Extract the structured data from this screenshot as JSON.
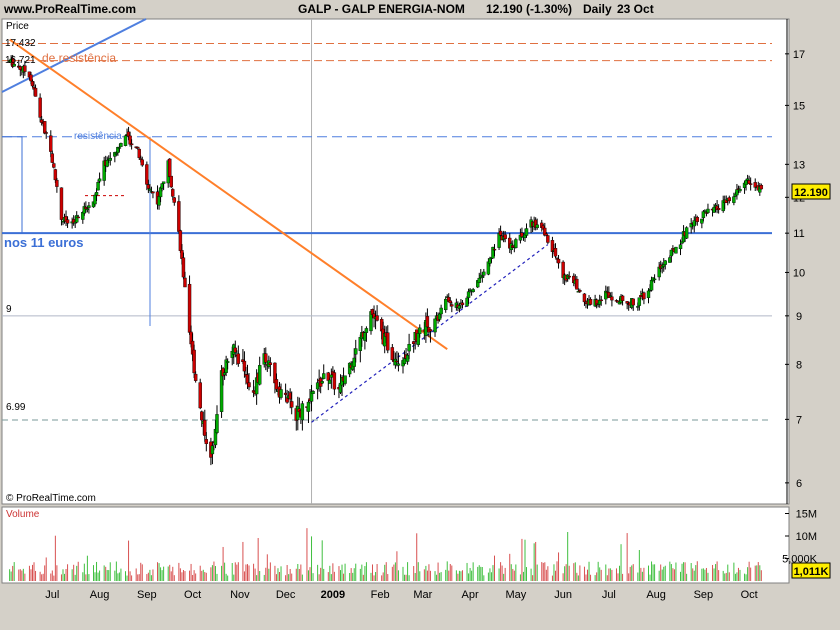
{
  "header": {
    "site": "www.ProRealTime.com",
    "title": "GALP - GALP ENERGIA-NOM",
    "last": "12.190 (-1.30%)",
    "period": "Daily",
    "date": "23 Oct"
  },
  "panel_labels": {
    "price": "Price",
    "volume": "Volume",
    "copyright": "© ProRealTime.com"
  },
  "price_axis": {
    "ticks": [
      "17",
      "15",
      "13",
      "12",
      "11",
      "10",
      "9",
      "8",
      "7",
      "6"
    ],
    "current": "12.190"
  },
  "volume_axis": {
    "ticks": [
      "15M",
      "10M",
      "5,000K"
    ],
    "current": "1,011K"
  },
  "time_axis": [
    "Jul",
    "Aug",
    "Sep",
    "Oct",
    "Nov",
    "Dec",
    "2009",
    "Feb",
    "Mar",
    "Apr",
    "May",
    "Jun",
    "Jul",
    "Aug",
    "Sep",
    "Oct"
  ],
  "annotations": {
    "resistance_top": "17.432",
    "resistance_mid": "16.721",
    "resistance_label": "de resistência",
    "resistance2_label": "resistência",
    "support_label": "nos 11 euros",
    "level_9": "9",
    "level_699": "6.99"
  },
  "colors": {
    "background": "#ffffff",
    "up": "#00aa00",
    "down": "#cc0000",
    "trend_down": "#ff7f2a",
    "trend_up_blue": "#4f7fdf",
    "level_blue": "#3b6fd6",
    "dashed_orange": "#e07040",
    "dashed_blue": "#4f7fdf",
    "dotted_support": "#2222bb"
  },
  "chart_data": {
    "type": "candlestick",
    "scale": "log",
    "ylim": [
      5.7,
      18.5
    ],
    "price_path": [
      [
        "2008-06-17",
        16.7
      ],
      [
        "2008-06-30",
        16.2
      ],
      [
        "2008-07-07",
        14.6
      ],
      [
        "2008-07-14",
        13.4
      ],
      [
        "2008-07-21",
        11.4
      ],
      [
        "2008-07-28",
        11.2
      ],
      [
        "2008-08-04",
        11.6
      ],
      [
        "2008-08-11",
        11.9
      ],
      [
        "2008-08-18",
        13.0
      ],
      [
        "2008-08-25",
        13.4
      ],
      [
        "2008-09-01",
        13.9
      ],
      [
        "2008-09-08",
        13.6
      ],
      [
        "2008-09-15",
        12.4
      ],
      [
        "2008-09-22",
        11.9
      ],
      [
        "2008-09-29",
        13.0
      ],
      [
        "2008-10-06",
        11.0
      ],
      [
        "2008-10-13",
        8.5
      ],
      [
        "2008-10-20",
        7.2
      ],
      [
        "2008-10-27",
        6.3
      ],
      [
        "2008-11-03",
        7.8
      ],
      [
        "2008-11-10",
        8.3
      ],
      [
        "2008-11-17",
        8.0
      ],
      [
        "2008-11-24",
        7.4
      ],
      [
        "2008-12-01",
        8.2
      ],
      [
        "2008-12-08",
        7.6
      ],
      [
        "2008-12-15",
        7.4
      ],
      [
        "2008-12-22",
        7.1
      ],
      [
        "2008-12-29",
        7.2
      ],
      [
        "2009-01-05",
        7.6
      ],
      [
        "2009-01-12",
        7.8
      ],
      [
        "2009-01-19",
        7.5
      ],
      [
        "2009-01-26",
        8.0
      ],
      [
        "2009-02-02",
        8.5
      ],
      [
        "2009-02-09",
        9.1
      ],
      [
        "2009-02-16",
        8.6
      ],
      [
        "2009-02-23",
        8.2
      ],
      [
        "2009-03-02",
        8.1
      ],
      [
        "2009-03-09",
        8.5
      ],
      [
        "2009-03-16",
        8.8
      ],
      [
        "2009-03-23",
        8.8
      ],
      [
        "2009-03-30",
        9.4
      ],
      [
        "2009-04-06",
        9.2
      ],
      [
        "2009-04-13",
        9.4
      ],
      [
        "2009-04-20",
        9.8
      ],
      [
        "2009-04-27",
        10.2
      ],
      [
        "2009-05-04",
        11.0
      ],
      [
        "2009-05-11",
        10.6
      ],
      [
        "2009-05-18",
        10.9
      ],
      [
        "2009-05-25",
        11.3
      ],
      [
        "2009-06-01",
        11.1
      ],
      [
        "2009-06-08",
        10.6
      ],
      [
        "2009-06-15",
        9.9
      ],
      [
        "2009-06-22",
        9.8
      ],
      [
        "2009-06-29",
        9.3
      ],
      [
        "2009-07-06",
        9.3
      ],
      [
        "2009-07-13",
        9.5
      ],
      [
        "2009-07-20",
        9.4
      ],
      [
        "2009-07-27",
        9.3
      ],
      [
        "2009-08-03",
        9.3
      ],
      [
        "2009-08-10",
        9.6
      ],
      [
        "2009-08-17",
        10.1
      ],
      [
        "2009-08-24",
        10.4
      ],
      [
        "2009-08-31",
        10.8
      ],
      [
        "2009-09-07",
        11.3
      ],
      [
        "2009-09-14",
        11.5
      ],
      [
        "2009-09-21",
        11.6
      ],
      [
        "2009-09-28",
        11.8
      ],
      [
        "2009-10-05",
        12.0
      ],
      [
        "2009-10-12",
        12.5
      ],
      [
        "2009-10-19",
        12.3
      ],
      [
        "2009-10-23",
        12.19
      ]
    ],
    "levels": [
      {
        "value": 17.432,
        "style": "dashed",
        "color": "orange"
      },
      {
        "value": 16.721,
        "style": "dashed",
        "color": "orange"
      },
      {
        "value": 13.9,
        "style": "dashed",
        "color": "blue"
      },
      {
        "value": 11.0,
        "style": "solid",
        "color": "blue"
      },
      {
        "value": 9.0,
        "style": "solid-thin",
        "color": "gray"
      },
      {
        "value": 6.99,
        "style": "dashed",
        "color": "gray"
      }
    ],
    "trendlines": [
      {
        "name": "downtrend",
        "from": [
          "2008-06-17",
          17.6
        ],
        "to": [
          "2009-03-31",
          8.3
        ]
      },
      {
        "name": "uptrend",
        "from": [
          "2009-01-01",
          6.95
        ],
        "to": [
          "2009-06-05",
          10.7
        ]
      }
    ]
  }
}
